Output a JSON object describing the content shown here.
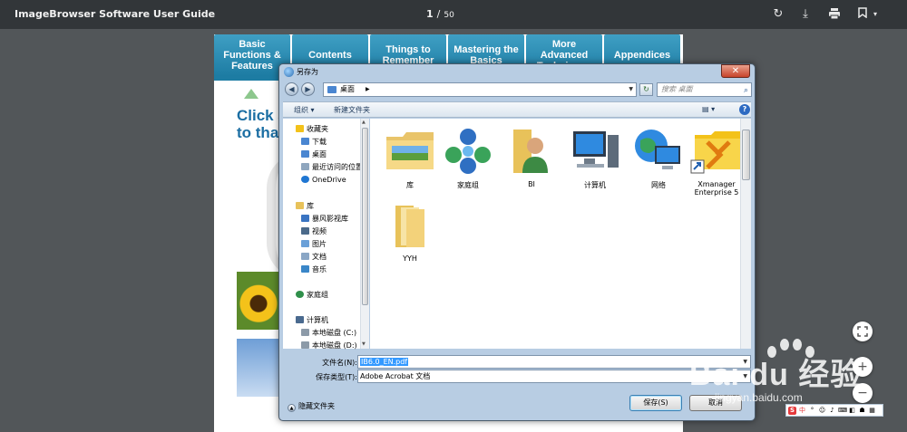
{
  "viewer": {
    "title": "ImageBrowser Software User Guide",
    "page_current": "1",
    "page_separator": "/",
    "page_total": "50"
  },
  "pdf": {
    "tabs": [
      "Basic Functions & Features",
      "Contents",
      "Things to Remember",
      "Mastering the Basics",
      "More Advanced Techniques",
      "Appendices"
    ],
    "click_line1": "Click a",
    "click_line2": "to tha"
  },
  "dialog": {
    "title": "另存为",
    "address": "桌面",
    "search_placeholder": "搜索 桌面",
    "organize": "组织 ▾",
    "new_folder": "新建文件夹",
    "nav_items": [
      {
        "label": "收藏夹",
        "color": "#f3c21a"
      },
      {
        "label": "下载",
        "color": "#4a86d1"
      },
      {
        "label": "桌面",
        "color": "#4a86d1"
      },
      {
        "label": "最近访问的位置",
        "color": "#8fa6be"
      },
      {
        "label": "OneDrive",
        "color": "#1f76d2"
      },
      {
        "label": "库",
        "color": "#e8c25a"
      },
      {
        "label": "暴风影视库",
        "color": "#3a74c2"
      },
      {
        "label": "视频",
        "color": "#4b6a8a"
      },
      {
        "label": "图片",
        "color": "#6aa0d8"
      },
      {
        "label": "文档",
        "color": "#8aa6c5"
      },
      {
        "label": "音乐",
        "color": "#3a86c8"
      },
      {
        "label": "家庭组",
        "color": "#2f8f4a"
      },
      {
        "label": "计算机",
        "color": "#4a6a8f"
      },
      {
        "label": "本地磁盘 (C:)",
        "color": "#8c9aa8"
      },
      {
        "label": "本地磁盘 (D:)",
        "color": "#8c9aa8"
      }
    ],
    "files": [
      {
        "label": "库",
        "icon": "library-icon"
      },
      {
        "label": "家庭组",
        "icon": "homegroup-icon"
      },
      {
        "label": "BI",
        "icon": "user-folder-icon"
      },
      {
        "label": "计算机",
        "icon": "computer-icon"
      },
      {
        "label": "网络",
        "icon": "network-icon"
      },
      {
        "label": "Xmanager Enterprise 5",
        "icon": "xmanager-shortcut-icon"
      },
      {
        "label": "YYH",
        "icon": "folder-icon"
      }
    ],
    "filename_label": "文件名(N):",
    "filename_value": "IB6.0_EN.pdf",
    "filetype_label": "保存类型(T):",
    "filetype_value": "Adobe Acrobat 文档",
    "hide_folders": "隐藏文件夹",
    "save_button": "保存(S)",
    "cancel_button": "取消"
  },
  "watermark": {
    "brand": "Bai du 经验",
    "url": "jingyan.baidu.com"
  }
}
